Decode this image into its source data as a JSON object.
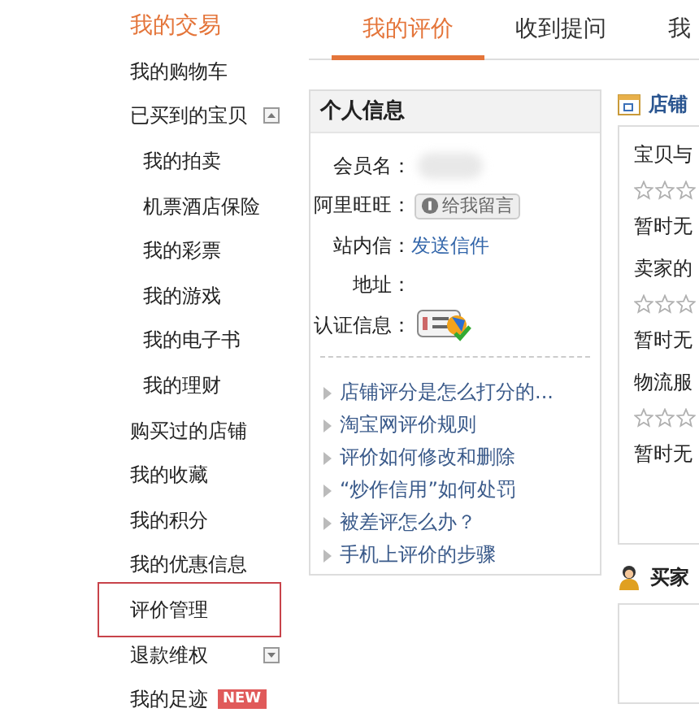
{
  "sidebar": {
    "title": "我的交易",
    "items": [
      {
        "label": "我的购物车",
        "selected": false
      },
      {
        "label": "已买到的宝贝",
        "selected": false,
        "expanded": true,
        "children": [
          {
            "label": "我的拍卖",
            "selected": false
          },
          {
            "label": "机票酒店保险",
            "selected": false
          },
          {
            "label": "我的彩票",
            "selected": false
          },
          {
            "label": "我的游戏",
            "selected": false
          },
          {
            "label": "我的电子书",
            "selected": false
          },
          {
            "label": "我的理财",
            "selected": false
          }
        ]
      },
      {
        "label": "购买过的店铺",
        "selected": false
      },
      {
        "label": "我的收藏",
        "selected": false
      },
      {
        "label": "我的积分",
        "selected": false
      },
      {
        "label": "我的优惠信息",
        "selected": false
      },
      {
        "label": "评价管理",
        "selected": true
      },
      {
        "label": "退款维权",
        "selected": false,
        "expanded": false
      },
      {
        "label": "我的足迹",
        "selected": false,
        "badge": "NEW"
      }
    ]
  },
  "tabs": [
    {
      "label": "我的评价",
      "selected": true
    },
    {
      "label": "收到提问",
      "selected": false
    },
    {
      "label": "我",
      "selected": false
    }
  ],
  "profile": {
    "title": "个人信息",
    "fields": [
      {
        "label": "会员名：",
        "kind": "blurred"
      },
      {
        "label": "阿里旺旺：",
        "kind": "button",
        "value": "给我留言"
      },
      {
        "label": "站内信：",
        "kind": "link",
        "value": "发送信件"
      },
      {
        "label": "地址：",
        "kind": "text"
      },
      {
        "label": "认证信息：",
        "kind": "badge"
      }
    ],
    "links": [
      "店铺评分是怎么打分的...",
      "淘宝网评价规则",
      "评价如何修改和删除",
      "“炒作信用”如何处罚",
      "被差评怎么办？",
      "手机上评价的步骤"
    ]
  },
  "shop_rating": {
    "title": "店铺",
    "items": [
      {
        "label": "宝贝与",
        "stars": 0,
        "note": "暂时无"
      },
      {
        "label": "卖家的",
        "stars": 0,
        "note": "暂时无"
      },
      {
        "label": "物流服",
        "stars": 0,
        "note": "暂时无"
      }
    ]
  },
  "buyer": {
    "title": "买家"
  }
}
